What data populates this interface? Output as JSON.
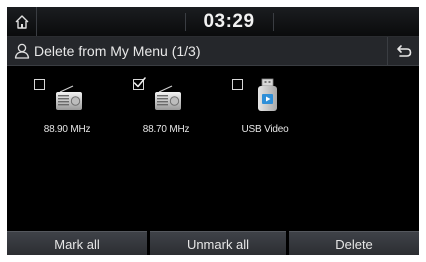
{
  "status_bar": {
    "time": "03:29",
    "home_icon": "home-icon"
  },
  "title_bar": {
    "icon": "person-icon",
    "title": "Delete from My Menu (1/3)",
    "back_icon": "back-icon"
  },
  "items": [
    {
      "label": "88.90 MHz",
      "checked": false,
      "icon": "radio-icon"
    },
    {
      "label": "88.70 MHz",
      "checked": true,
      "icon": "radio-icon"
    },
    {
      "label": "USB Video",
      "checked": false,
      "icon": "usb-video-icon"
    }
  ],
  "buttons": {
    "mark_all": "Mark all",
    "unmark_all": "Unmark all",
    "delete": "Delete"
  },
  "colors": {
    "background": "#000000",
    "title_bar": "#25272b",
    "button": "#3f4248",
    "usb_blue": "#2f8fd8"
  }
}
